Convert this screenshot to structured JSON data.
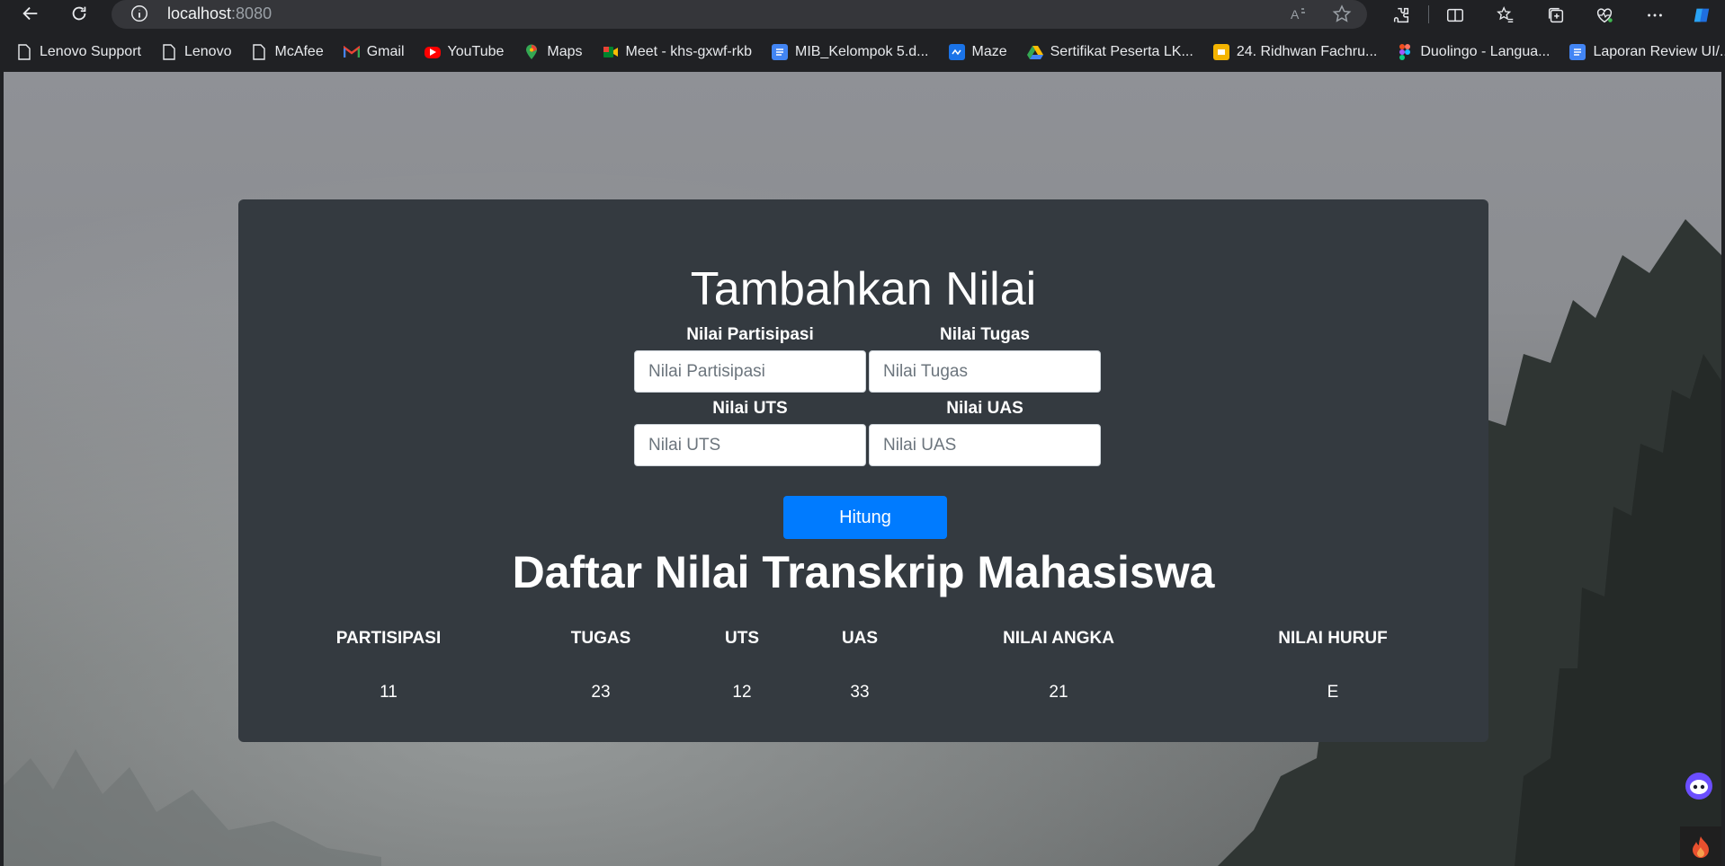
{
  "browser": {
    "url_host": "localhost",
    "url_port": ":8080"
  },
  "bookmarks": [
    {
      "label": "Lenovo Support",
      "icon": "page-icon"
    },
    {
      "label": "Lenovo",
      "icon": "page-icon"
    },
    {
      "label": "McAfee",
      "icon": "page-icon"
    },
    {
      "label": "Gmail",
      "icon": "gmail-icon"
    },
    {
      "label": "YouTube",
      "icon": "youtube-icon"
    },
    {
      "label": "Maps",
      "icon": "maps-icon"
    },
    {
      "label": "Meet - khs-gxwf-rkb",
      "icon": "meet-icon"
    },
    {
      "label": "MIB_Kelompok 5.d...",
      "icon": "docs-icon"
    },
    {
      "label": "Maze",
      "icon": "maze-icon"
    },
    {
      "label": "Sertifikat Peserta LK...",
      "icon": "drive-icon"
    },
    {
      "label": "24. Ridhwan Fachru...",
      "icon": "slides-icon"
    },
    {
      "label": "Duolingo - Langua...",
      "icon": "figma-icon"
    },
    {
      "label": "Laporan Review UI/...",
      "icon": "docs-icon"
    }
  ],
  "form": {
    "title": "Tambahkan Nilai",
    "partisipasi_label": "Nilai Partisipasi",
    "partisipasi_placeholder": "Nilai Partisipasi",
    "tugas_label": "Nilai Tugas",
    "tugas_placeholder": "Nilai Tugas",
    "uts_label": "Nilai UTS",
    "uts_placeholder": "Nilai UTS",
    "uas_label": "Nilai UAS",
    "uas_placeholder": "Nilai UAS",
    "submit_label": "Hitung"
  },
  "table": {
    "title": "Daftar Nilai Transkrip Mahasiswa",
    "headers": [
      "PARTISIPASI",
      "TUGAS",
      "UTS",
      "UAS",
      "NILAI ANGKA",
      "NILAI HURUF"
    ],
    "rows": [
      [
        "11",
        "23",
        "12",
        "33",
        "21",
        "E"
      ]
    ]
  },
  "colors": {
    "card_bg": "#343a40",
    "button_bg": "#007bff"
  }
}
